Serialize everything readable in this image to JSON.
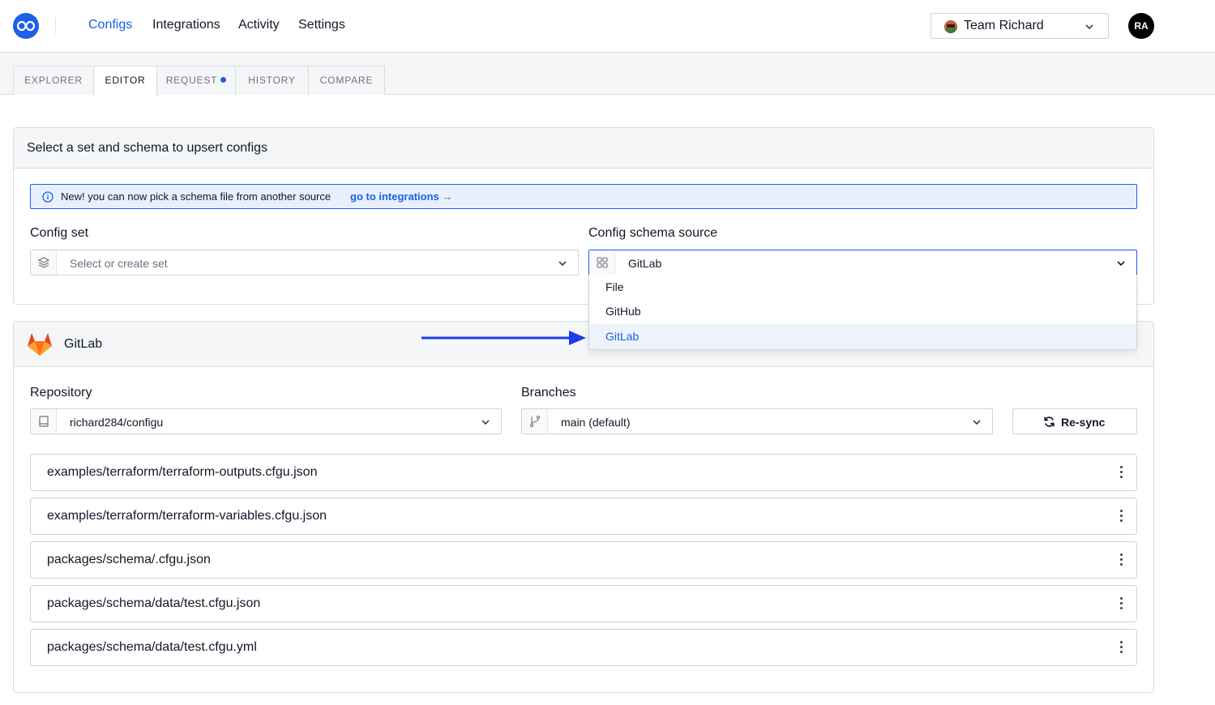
{
  "nav": {
    "links": [
      "Configs",
      "Integrations",
      "Activity",
      "Settings"
    ],
    "team": "Team Richard",
    "user_initials": "RA"
  },
  "tabs": [
    {
      "label": "EXPLORER"
    },
    {
      "label": "EDITOR"
    },
    {
      "label": "REQUEST"
    },
    {
      "label": "HISTORY"
    },
    {
      "label": "COMPARE"
    }
  ],
  "upsert": {
    "title": "Select a set and schema to upsert configs",
    "notice_text": "New! you can now pick a schema file from another source",
    "notice_link": "go to integrations →",
    "config_set_label": "Config set",
    "config_set_placeholder": "Select or create set",
    "schema_source_label": "Config schema source",
    "schema_source_value": "GitLab",
    "schema_source_options": [
      "File",
      "GitHub",
      "GitLab"
    ]
  },
  "gitlab": {
    "title": "GitLab",
    "repository_label": "Repository",
    "repository_value": "richard284/configu",
    "branches_label": "Branches",
    "branch_value": "main (default)",
    "resync_label": "Re-sync",
    "files": [
      "examples/terraform/terraform-outputs.cfgu.json",
      "examples/terraform/terraform-variables.cfgu.json",
      "packages/schema/.cfgu.json",
      "packages/schema/data/test.cfgu.json",
      "packages/schema/data/test.cfgu.yml"
    ]
  },
  "colors": {
    "accent": "#1d5fe6",
    "selected_option_bg": "#eef3fb",
    "notice_bg": "#e8f0fe"
  }
}
